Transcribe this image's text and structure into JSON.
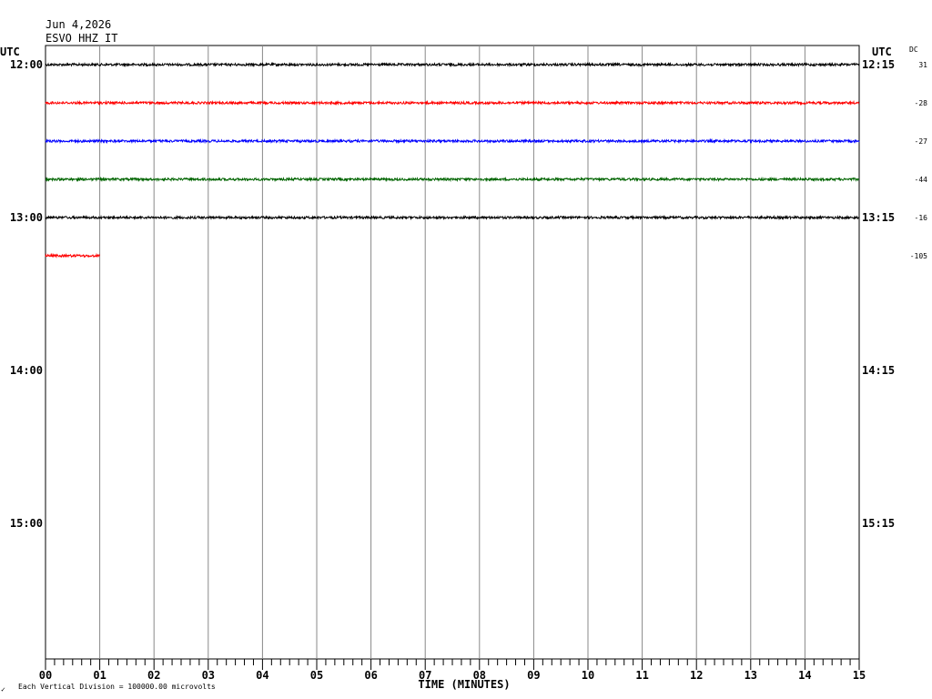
{
  "header": {
    "date": "Jun 4,2026",
    "station": "ESVO HHZ IT",
    "utc_left": "UTC",
    "utc_right": "UTC",
    "dc_label": "DC",
    "logo_mark": "✓",
    "footnote": "Each Vertical Division = 100000.00 microvolts"
  },
  "chart_data": {
    "type": "line",
    "xlabel": "TIME (MINUTES)",
    "ylabel": "",
    "xlim": [
      0,
      15
    ],
    "x_ticks": [
      "00",
      "01",
      "02",
      "03",
      "04",
      "05",
      "06",
      "07",
      "08",
      "09",
      "10",
      "11",
      "12",
      "13",
      "14",
      "15"
    ],
    "rows_total": 16,
    "left_hour_labels": [
      {
        "row": 0,
        "text": "12:00"
      },
      {
        "row": 4,
        "text": "13:00"
      },
      {
        "row": 8,
        "text": "14:00"
      },
      {
        "row": 12,
        "text": "15:00"
      }
    ],
    "right_hour_labels": [
      {
        "row": 0,
        "text": "12:15"
      },
      {
        "row": 4,
        "text": "13:15"
      },
      {
        "row": 8,
        "text": "14:15"
      },
      {
        "row": 12,
        "text": "15:15"
      }
    ],
    "series": [
      {
        "row": 0,
        "color": "#000000",
        "x_end": 15,
        "dc": "31"
      },
      {
        "row": 1,
        "color": "#ff0000",
        "x_end": 15,
        "dc": "-28"
      },
      {
        "row": 2,
        "color": "#0000ff",
        "x_end": 15,
        "dc": "-27"
      },
      {
        "row": 3,
        "color": "#006400",
        "x_end": 15,
        "dc": "-44"
      },
      {
        "row": 4,
        "color": "#000000",
        "x_end": 15,
        "dc": "-16"
      },
      {
        "row": 5,
        "color": "#ff0000",
        "x_end": 1,
        "dc": "-105"
      }
    ],
    "grid": true
  }
}
